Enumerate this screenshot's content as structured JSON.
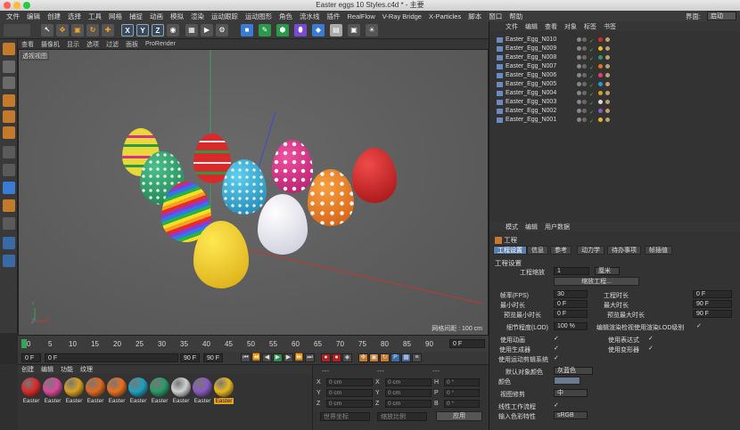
{
  "window": {
    "title": "Easter eggs 10 Styles.c4d * - 主要"
  },
  "menu": [
    "文件",
    "编辑",
    "创建",
    "选择",
    "工具",
    "网格",
    "捕捉",
    "动画",
    "模拟",
    "渲染",
    "运动跟踪",
    "运动图形",
    "角色",
    "流水线",
    "插件",
    "RealFlow",
    "V-Ray Bridge",
    "X-Particles",
    "脚本",
    "窗口",
    "帮助"
  ],
  "interface": {
    "label": "界面:",
    "value": "启动"
  },
  "toolbar": {
    "x": "X",
    "y": "Y",
    "z": "Z"
  },
  "viewport_menu": [
    "查看",
    "摄像机",
    "显示",
    "选项",
    "过滤",
    "面板",
    "ProRender"
  ],
  "viewport": {
    "label": "透视视图",
    "grid_label": "网格间距 : 100 cm",
    "axis_x": "X",
    "axis_y": "Y",
    "axis_z": "Z"
  },
  "timeline": {
    "ticks": [
      "0",
      "5",
      "10",
      "15",
      "20",
      "25",
      "30",
      "35",
      "40",
      "45",
      "50",
      "55",
      "60",
      "65",
      "70",
      "75",
      "80",
      "85",
      "90"
    ],
    "frame_right": "0 F"
  },
  "transport": {
    "start": "0 F",
    "current": "0 F",
    "end": "90 F",
    "end2": "90 F"
  },
  "material_menu": [
    "创建",
    "编辑",
    "功能",
    "纹理"
  ],
  "materials": [
    {
      "label": "Easter",
      "color": "#d82a2a"
    },
    {
      "label": "Easter",
      "color": "#d84a9a"
    },
    {
      "label": "Easter",
      "color": "#d8a020"
    },
    {
      "label": "Easter",
      "color": "#e06820"
    },
    {
      "label": "Easter",
      "color": "#e87020"
    },
    {
      "label": "Easter",
      "color": "#20a0c0"
    },
    {
      "label": "Easter",
      "color": "#2a9a6a"
    },
    {
      "label": "Easter",
      "color": "#d0d0d0"
    },
    {
      "label": "Easter",
      "color": "#8a5ac0"
    },
    {
      "label": "Easter",
      "color": "#e8b820"
    }
  ],
  "coords": {
    "header": [
      "---",
      "---",
      "---"
    ],
    "rows": [
      {
        "a": "X",
        "av": "0 cm",
        "b": "X",
        "bv": "0 cm",
        "c": "H",
        "cv": "0 °"
      },
      {
        "a": "Y",
        "av": "0 cm",
        "b": "Y",
        "bv": "0 cm",
        "c": "P",
        "cv": "0 °"
      },
      {
        "a": "Z",
        "av": "0 cm",
        "b": "Z",
        "bv": "0 cm",
        "c": "B",
        "cv": "0 °"
      }
    ],
    "world": "世界坐标",
    "scale": "缩放比例",
    "apply": "应用"
  },
  "object_menu": [
    "文件",
    "编辑",
    "查看",
    "对象",
    "标签",
    "书签"
  ],
  "objects": [
    "Easter_Egg_N010",
    "Easter_Egg_N009",
    "Easter_Egg_N008",
    "Easter_Egg_N007",
    "Easter_Egg_N006",
    "Easter_Egg_N005",
    "Easter_Egg_N004",
    "Easter_Egg_N003",
    "Easter_Egg_N002",
    "Easter_Egg_N001"
  ],
  "object_colors": [
    "#d82a2a",
    "#e8c020",
    "#2a9a6a",
    "#e87020",
    "#e04070",
    "#20a0c0",
    "#d8a020",
    "#d8d8d8",
    "#8a5ac0",
    "#e8b820"
  ],
  "attr_menu": [
    "模式",
    "编辑",
    "用户数据"
  ],
  "attr": {
    "section": "工程",
    "tabs": [
      "工程设置",
      "信息",
      "参考",
      "动力学",
      "待办事项",
      "帧插值"
    ],
    "group": "工程设置",
    "scale_label": "工程缩放",
    "scale_value": "1",
    "scale_unit": "厘米",
    "scale_button": "缩放工程...",
    "fps_label": "帧率(FPS)",
    "fps_value": "30",
    "time_label": "工程时长",
    "time_value": "0 F",
    "min_label": "最小时长",
    "min_value": "0 F",
    "max_label": "最大时长",
    "max_value": "90 F",
    "pmin_label": "预览最小时长",
    "pmin_value": "0 F",
    "pmax_label": "预览最大时长",
    "pmax_value": "90 F",
    "lod_label": "细节程度(LOD)",
    "lod_value": "100 %",
    "lod_check": "编辑渲染检视使用渲染LOD级别",
    "anim_label": "使用动画",
    "expr_label": "使用表达式",
    "gen_label": "使用生成器",
    "deform_label": "使用变形器",
    "motion_label": "使用运动剪辑系统",
    "objcolor_label": "默认对象颜色",
    "objcolor_value": "灰蓝色",
    "color_label": "颜色",
    "clip_label": "视图修剪",
    "clip_value": "中",
    "linear_label": "线性工作流程",
    "input_label": "输入色彩特性",
    "input_value": "sRGB"
  }
}
